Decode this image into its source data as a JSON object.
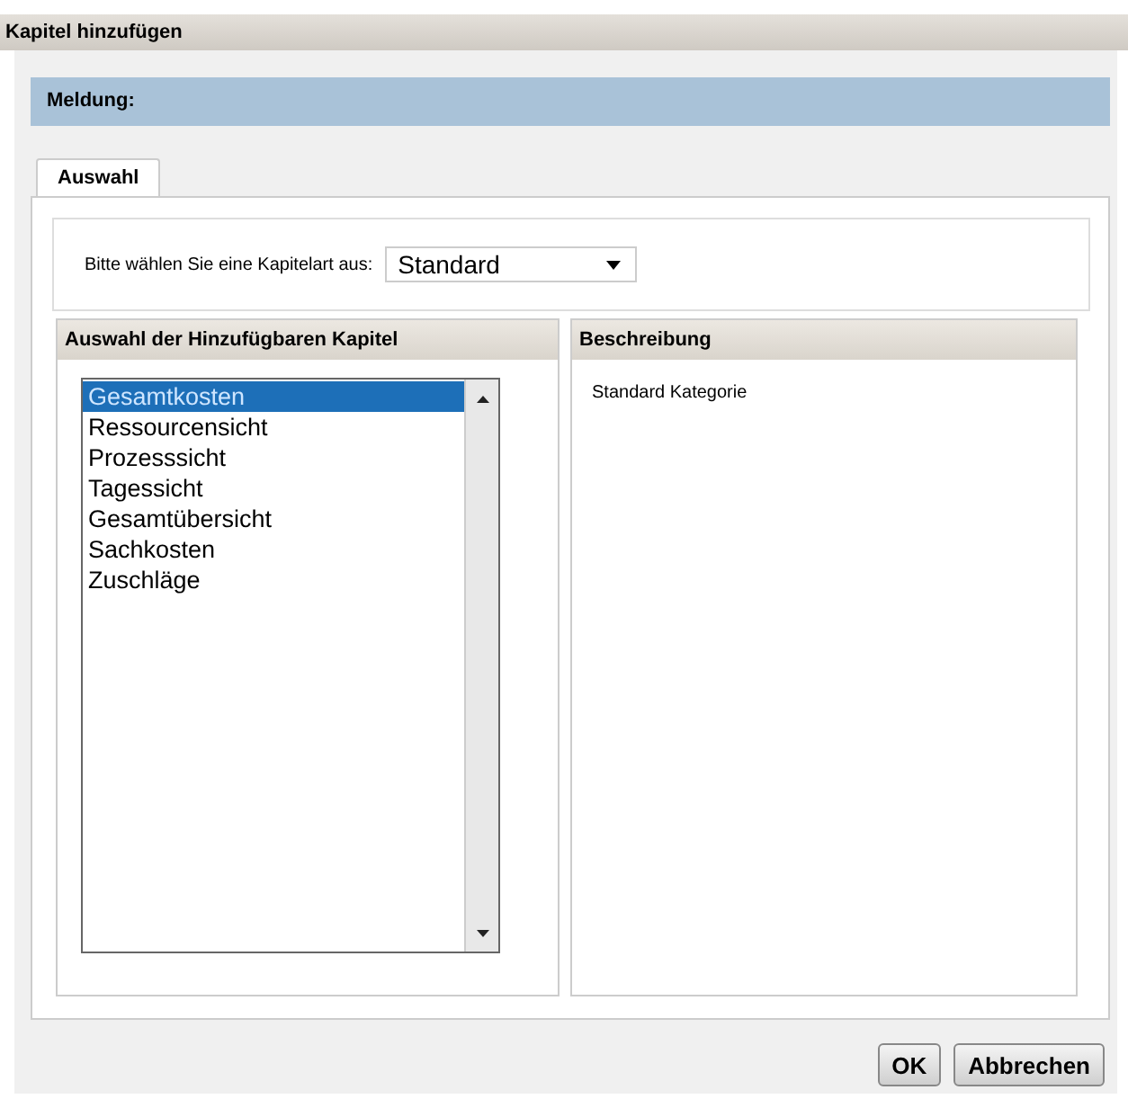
{
  "window": {
    "title": "Kapitel hinzufügen"
  },
  "message": {
    "label": "Meldung:"
  },
  "tabs": [
    {
      "label": "Auswahl",
      "selected": true
    }
  ],
  "chapter_type": {
    "label": "Bitte wählen Sie eine Kapitelart aus:",
    "value": "Standard"
  },
  "chapters": {
    "heading": "Auswahl der Hinzufügbaren Kapitel",
    "items": [
      {
        "label": "Gesamtkosten",
        "selected": true
      },
      {
        "label": "Ressourcensicht",
        "selected": false
      },
      {
        "label": "Prozesssicht",
        "selected": false
      },
      {
        "label": "Tagessicht",
        "selected": false
      },
      {
        "label": "Gesamtübersicht",
        "selected": false
      },
      {
        "label": "Sachkosten",
        "selected": false
      },
      {
        "label": "Zuschläge",
        "selected": false
      }
    ]
  },
  "description": {
    "heading": "Beschreibung",
    "text": "Standard Kategorie"
  },
  "buttons": [
    "OK",
    "Abbrechen"
  ]
}
